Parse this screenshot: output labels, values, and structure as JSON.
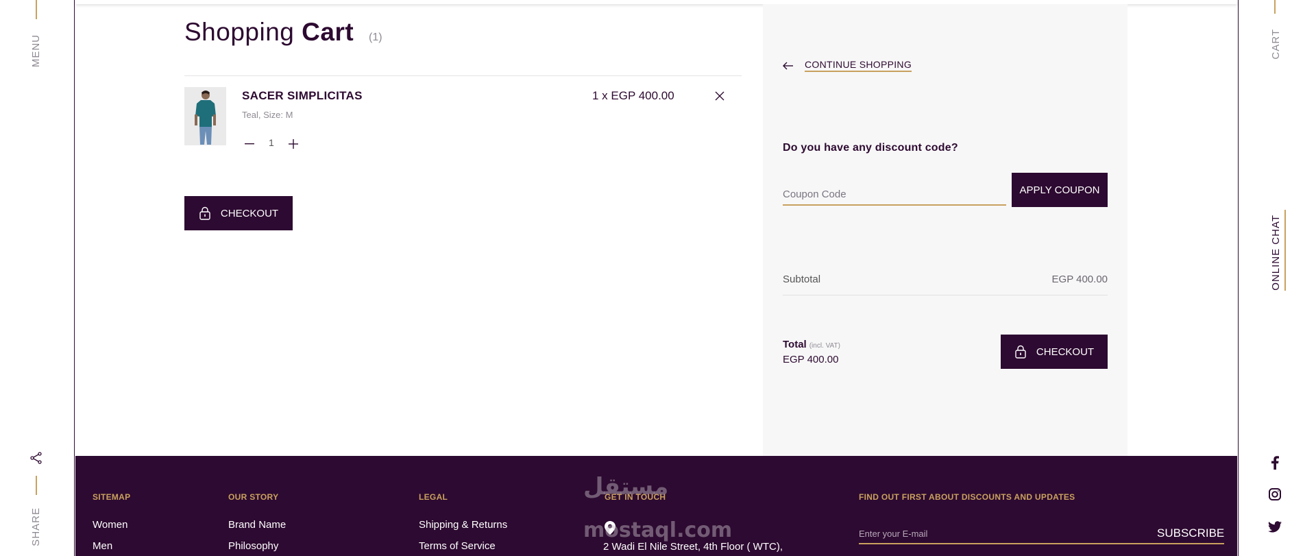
{
  "rails": {
    "menu": "MENU",
    "share": "SHARE",
    "cart": "CART",
    "online_chat": "ONLINE CHAT"
  },
  "cart": {
    "title_light": "Shopping",
    "title_bold": "Cart",
    "count": "(1)",
    "items": [
      {
        "name": "SACER SIMPLICITAS",
        "variant": "Teal, Size: M",
        "quantity": "1",
        "price_line": "1 x EGP 400.00"
      }
    ],
    "checkout_label": "CHECKOUT"
  },
  "summary": {
    "continue_label": "CONTINUE SHOPPING",
    "discount_question": "Do you have any discount code?",
    "coupon_placeholder": "Coupon Code",
    "apply_label": "APPLY COUPON",
    "subtotal_label": "Subtotal",
    "subtotal_value": "EGP 400.00",
    "total_label": "Total",
    "total_note": "(incl. VAT)",
    "total_value": "EGP 400.00",
    "checkout_label": "CHECKOUT"
  },
  "footer": {
    "sitemap": {
      "heading": "SITEMAP",
      "links": [
        "Women",
        "Men"
      ]
    },
    "our_story": {
      "heading": "OUR STORY",
      "links": [
        "Brand Name",
        "Philosophy"
      ]
    },
    "legal": {
      "heading": "LEGAL",
      "links": [
        "Shipping & Returns",
        "Terms of Service"
      ]
    },
    "contact": {
      "heading": "GET IN TOUCH",
      "address": "2 Wadi El Nile Street, 4th Floor ( WTC),"
    },
    "newsletter": {
      "heading": "FIND OUT FIRST ABOUT DISCOUNTS AND UPDATES",
      "placeholder": "Enter your E-mail",
      "subscribe_label": "SUBSCRIBE"
    },
    "watermark": {
      "arabic": "مستقل",
      "latin": "mostaql.com"
    }
  },
  "icons": {
    "share": "share-icon",
    "facebook": "facebook-icon",
    "instagram": "instagram-icon",
    "twitter": "twitter-icon",
    "lock": "lock-icon",
    "close": "close-icon",
    "arrow_left": "arrow-left-icon",
    "minus": "minus-icon",
    "plus": "plus-icon",
    "pin": "map-pin-icon"
  },
  "colors": {
    "brand_dark": "#2d0a31",
    "accent_gold": "#c9a15e",
    "panel_bg": "#f7f7f7"
  }
}
